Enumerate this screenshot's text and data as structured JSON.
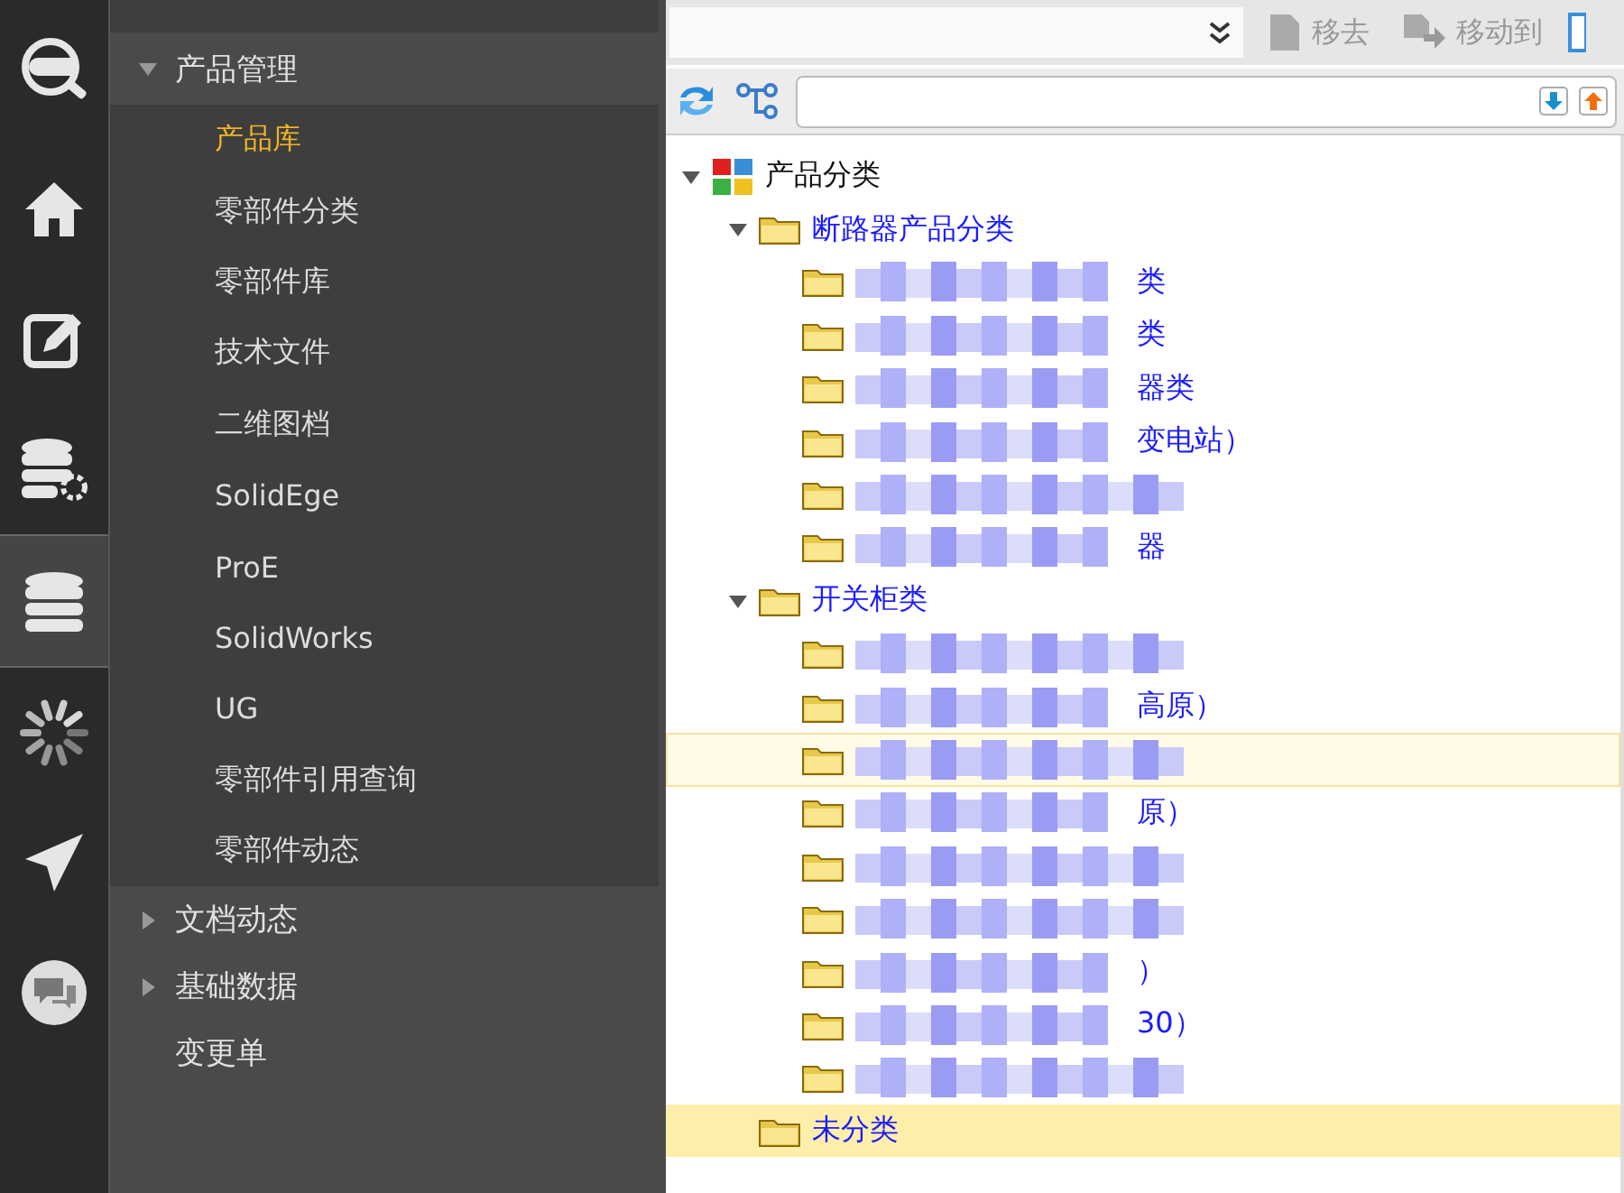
{
  "sidebar_icons": [
    {
      "kind": "logo",
      "selected": false
    },
    {
      "kind": "home",
      "selected": false
    },
    {
      "kind": "edit",
      "selected": false
    },
    {
      "kind": "db-settings",
      "selected": false
    },
    {
      "kind": "database",
      "selected": true
    },
    {
      "kind": "loading",
      "selected": false
    },
    {
      "kind": "send",
      "selected": false
    },
    {
      "kind": "chat",
      "selected": false
    }
  ],
  "menu": [
    {
      "label": "产品管理",
      "expanded": true,
      "has_children": true,
      "children": [
        {
          "label": "产品库",
          "selected": true
        },
        {
          "label": "零部件分类",
          "selected": false
        },
        {
          "label": "零部件库",
          "selected": false
        },
        {
          "label": "技术文件",
          "selected": false
        },
        {
          "label": "二维图档",
          "selected": false
        },
        {
          "label": "SolidEge",
          "selected": false
        },
        {
          "label": "ProE",
          "selected": false
        },
        {
          "label": "SolidWorks",
          "selected": false
        },
        {
          "label": "UG",
          "selected": false
        },
        {
          "label": "零部件引用查询",
          "selected": false
        },
        {
          "label": "零部件动态",
          "selected": false
        }
      ]
    },
    {
      "label": "文档动态",
      "expanded": false,
      "has_children": true
    },
    {
      "label": "基础数据",
      "expanded": false,
      "has_children": true
    },
    {
      "label": "变更单",
      "expanded": false,
      "has_children": false
    }
  ],
  "toolbar": {
    "buttons": [
      {
        "label": "移去",
        "kind": "remove"
      },
      {
        "label": "移动到",
        "kind": "move"
      }
    ]
  },
  "tree": {
    "label": "产品分类",
    "expanded": true,
    "children": [
      {
        "label": "断路器产品分类",
        "expanded": true,
        "children": [
          {
            "label": "类",
            "redacted": true
          },
          {
            "label": "类",
            "redacted": true
          },
          {
            "label": "器类",
            "redacted": true
          },
          {
            "label": "变电站）",
            "redacted": true
          },
          {
            "redacted": true
          },
          {
            "label": "器",
            "redacted": true
          }
        ]
      },
      {
        "label": "开关柜类",
        "expanded": true,
        "children": [
          {
            "redacted": true
          },
          {
            "label": "高原）",
            "redacted": true
          },
          {
            "redacted": true,
            "hovered": true
          },
          {
            "label": "原）",
            "redacted": true
          },
          {
            "redacted": true
          },
          {
            "redacted": true
          },
          {
            "label": "）",
            "redacted": true
          },
          {
            "label": "30）",
            "redacted": true
          },
          {
            "redacted": true
          }
        ]
      },
      {
        "label": "未分类",
        "selected": true
      }
    ]
  }
}
